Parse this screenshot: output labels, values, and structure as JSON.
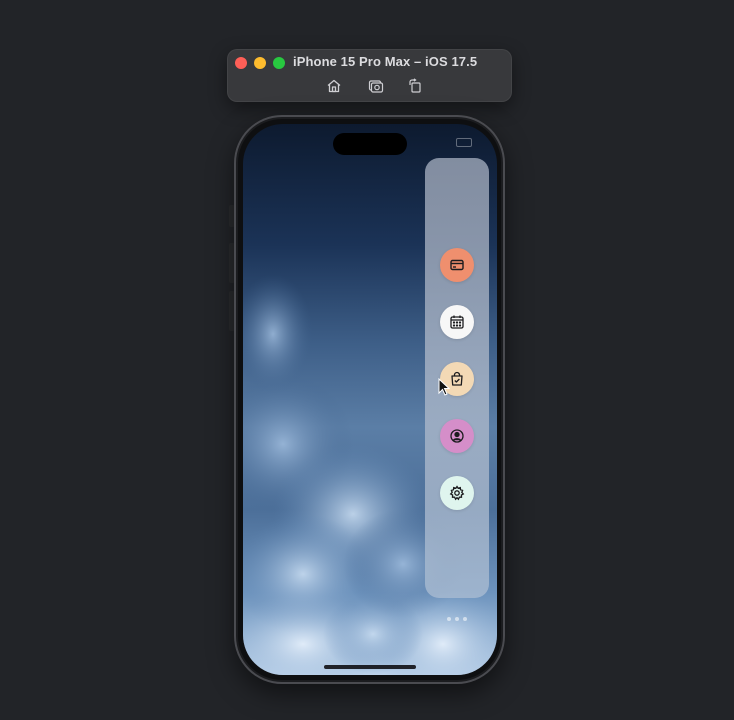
{
  "window": {
    "title": "iPhone 15 Pro Max – iOS 17.5",
    "toolbar_icons": [
      "house-icon",
      "camera-screenshot-icon",
      "rotate-icon"
    ]
  },
  "simulator": {
    "menu_buttons": [
      {
        "icon": "credit-card-icon",
        "color": "#ef8f6e"
      },
      {
        "icon": "calendar-icon",
        "color": "#f7f7f7"
      },
      {
        "icon": "shopping-bag-check-icon",
        "color": "#f3d9b5"
      },
      {
        "icon": "user-circle-icon",
        "color": "#d58ec9"
      },
      {
        "icon": "gear-icon",
        "color": "#dff5ee"
      }
    ],
    "more_icon": "more-dots-icon"
  }
}
